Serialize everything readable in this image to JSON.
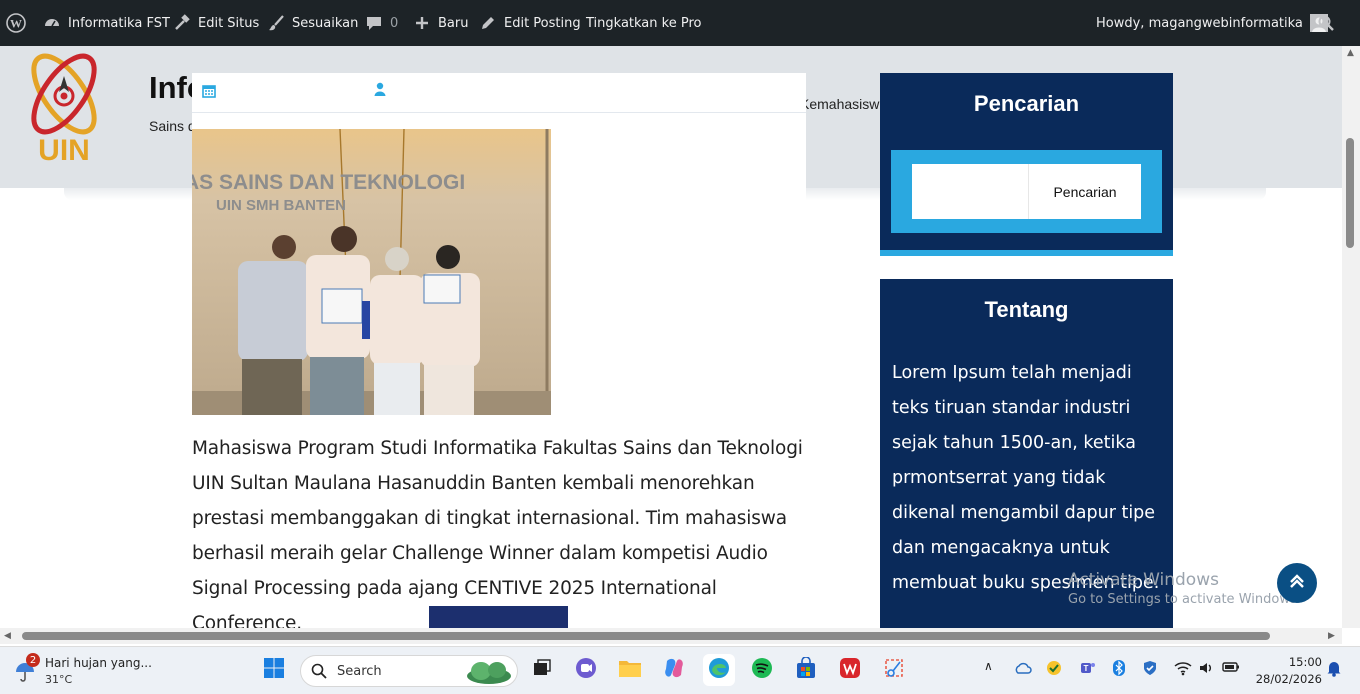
{
  "adminbar": {
    "site_name": "Informatika FST",
    "edit_site": "Edit Situs",
    "customize": "Sesuaikan",
    "comments_count": "0",
    "new": "Baru",
    "edit_post": "Edit Posting",
    "upgrade": "Tingkatkan ke Pro",
    "howdy": "Howdy, magangwebinformatika"
  },
  "header": {
    "title": "Info",
    "description": "Sains d",
    "nav_item": "Kemahasiswaan"
  },
  "post": {
    "article_text": "Mahasiswa Program Studi Informatika Fakultas Sains dan Teknologi UIN Sultan Maulana Hasanuddin Banten kembali menorehkan prestasi membanggakan di tingkat internasional. Tim mahasiswa berhasil meraih gelar Challenge Winner dalam kompetisi Audio Signal Processing pada ajang CENTIVE 2025 International Conference.",
    "photo_sign_line1": "AS SAINS DAN TEKNOLOGI",
    "photo_sign_line2": "UIN SMH BANTEN"
  },
  "sidebar": {
    "search_title": "Pencarian",
    "search_button": "Pencarian",
    "search_placeholder": "",
    "about_title": "Tentang",
    "about_text": "Lorem Ipsum telah menjadi teks tiruan standar industri sejak tahun 1500-an, ketika prmontserrat yang tidak dikenal mengambil dapur tipe dan mengacaknya untuk membuat buku spesimen tipe."
  },
  "watermark": {
    "line1": "Activate Windows",
    "line2": "Go to Settings to activate Windows."
  },
  "taskbar": {
    "weather_text": "Hari hujan yang...",
    "temperature": "31°C",
    "notification_count": "2",
    "search_label": "Search",
    "time": "15:00",
    "date": "28/02/2026"
  },
  "colors": {
    "admin_bg": "#1d2327",
    "widget_bg": "#0a2a5a",
    "accent": "#2aa8e0",
    "scroll_top_bg": "#0a4f84"
  }
}
